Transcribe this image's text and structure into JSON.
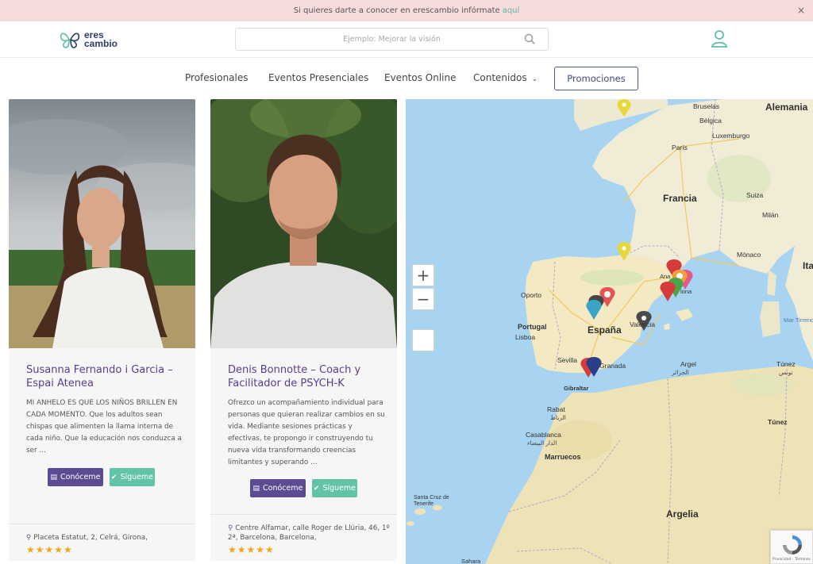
{
  "announcement": {
    "text": "Si quieres darte a conocer en erescambio infórmate",
    "link": "aquí",
    "close": "×"
  },
  "header": {
    "logo_line1": "eres",
    "logo_line2": "cambio",
    "search_placeholder": "Ejemplo: Mejorar la visión"
  },
  "nav": {
    "items": [
      "Profesionales",
      "Eventos Presenciales",
      "Eventos Online",
      "Contenidos"
    ],
    "promo": "Promociones"
  },
  "cards": [
    {
      "name": "Susanna Fernando i Garcia – Espai Atenea",
      "description": "MI ANHELO ES QUE LOS NIÑOS BRILLEN EN CADA MOMENTO. Que los adultos sean chispas que alimenten la llama interna de cada niño. Que la educación nos conduzca a ser …",
      "btn_know": "Conóceme",
      "btn_follow": "Sígueme",
      "address": "Placeta Estatut, 2, Celrá, Girona,",
      "stars": "★★★★★",
      "rating": 5
    },
    {
      "name": "Denis Bonnotte – Coach y Facilitador de PSYCH-K",
      "description": "Ofrezco un acompañamiento individual para personas que quieran realizar cambios en su vida. Mediante sesiones prácticas y efectivas, te propongo ir construyendo tu nueva vida transformando creencias limitantes y superando …",
      "btn_know": "Conóceme",
      "btn_follow": "Sígueme",
      "address": "Centre Alfamar, calle Roger de Llúria, 46, 1º 2ª, Barcelona, Barcelona,",
      "stars": "★★★★★",
      "rating": 5
    }
  ],
  "map": {
    "zoom_in": "+",
    "zoom_out": "−",
    "countries": [
      "Alemania",
      "Francia",
      "España",
      "Portugal",
      "Marruecos",
      "Argelia",
      "Ita"
    ],
    "cities": [
      "Bruselas",
      "Bélgica",
      "Luxemburgo",
      "París",
      "Suiza",
      "Milán",
      "Mónaco",
      "Oporto",
      "Lisboa",
      "Valencia",
      "Sevilla",
      "Granada",
      "Gibraltar",
      "Rabat",
      "Casablanca",
      "Argel",
      "Túnez",
      "Túnez",
      "Santa Cruz de Tenerife",
      "Sahara",
      "Ana",
      "lona"
    ],
    "arabic": [
      "الرباط",
      "الدار البيضاء",
      "الجزائر",
      "تونس"
    ],
    "sea": "Mar Tirreno",
    "recaptcha": "Privacidad - Términos"
  },
  "colors": {
    "announce_bg": "#f6dcdc",
    "brand_purple": "#5c4a92",
    "brand_green": "#63c3a6",
    "star": "#f4a418"
  }
}
